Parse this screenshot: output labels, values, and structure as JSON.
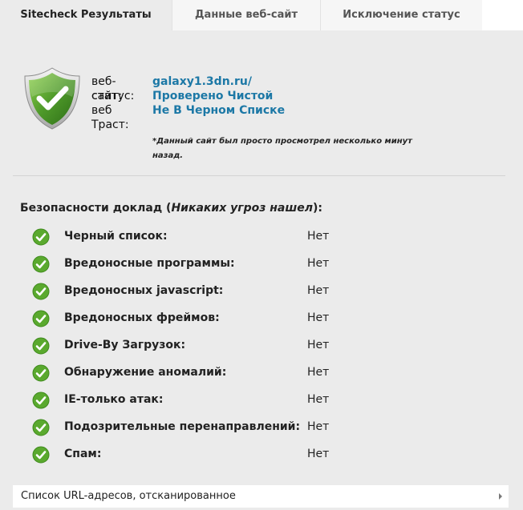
{
  "tabs": [
    {
      "label": "Sitecheck Результаты",
      "active": true
    },
    {
      "label": "Данные веб-сайт",
      "active": false
    },
    {
      "label": "Исключение статус",
      "active": false
    }
  ],
  "summary": {
    "website_label": "веб-сайт:",
    "website_value": "galaxy1.3dn.ru/",
    "status_label": "статус:",
    "status_value": "Проверено Чистой",
    "trust_label_1": "веб",
    "trust_label_2": "Траст:",
    "trust_value": "Не В Черном Списке",
    "note": "*Данный сайт был просто просмотрел несколько минут назад."
  },
  "report": {
    "title_prefix": "Безопасности доклад (",
    "title_emphasis": "Никаких угроз нашел",
    "title_suffix": "):",
    "items": [
      {
        "label": "Черный список:",
        "value": "Нет"
      },
      {
        "label": "Вредоносные программы:",
        "value": "Нет"
      },
      {
        "label": "Вредоносных javascript:",
        "value": "Нет"
      },
      {
        "label": "Вредоносных фреймов:",
        "value": "Нет"
      },
      {
        "label": "Drive-By Загрузок:",
        "value": "Нет"
      },
      {
        "label": "Обнаружение аномалий:",
        "value": "Нет"
      },
      {
        "label": "IE-только атак:",
        "value": "Нет"
      },
      {
        "label": "Подозрительные перенаправлений:",
        "value": "Нет"
      },
      {
        "label": "Спам:",
        "value": "Нет"
      }
    ]
  },
  "url_bar": {
    "label": "Список URL-адресов, отсканированное"
  },
  "icons": {
    "shield": "shield-check-icon",
    "check": "check-circle-icon",
    "arrow": "chevron-right-icon"
  },
  "colors": {
    "link": "#1c78a6",
    "check_green": "#5aa92e",
    "background": "#ebebeb"
  }
}
